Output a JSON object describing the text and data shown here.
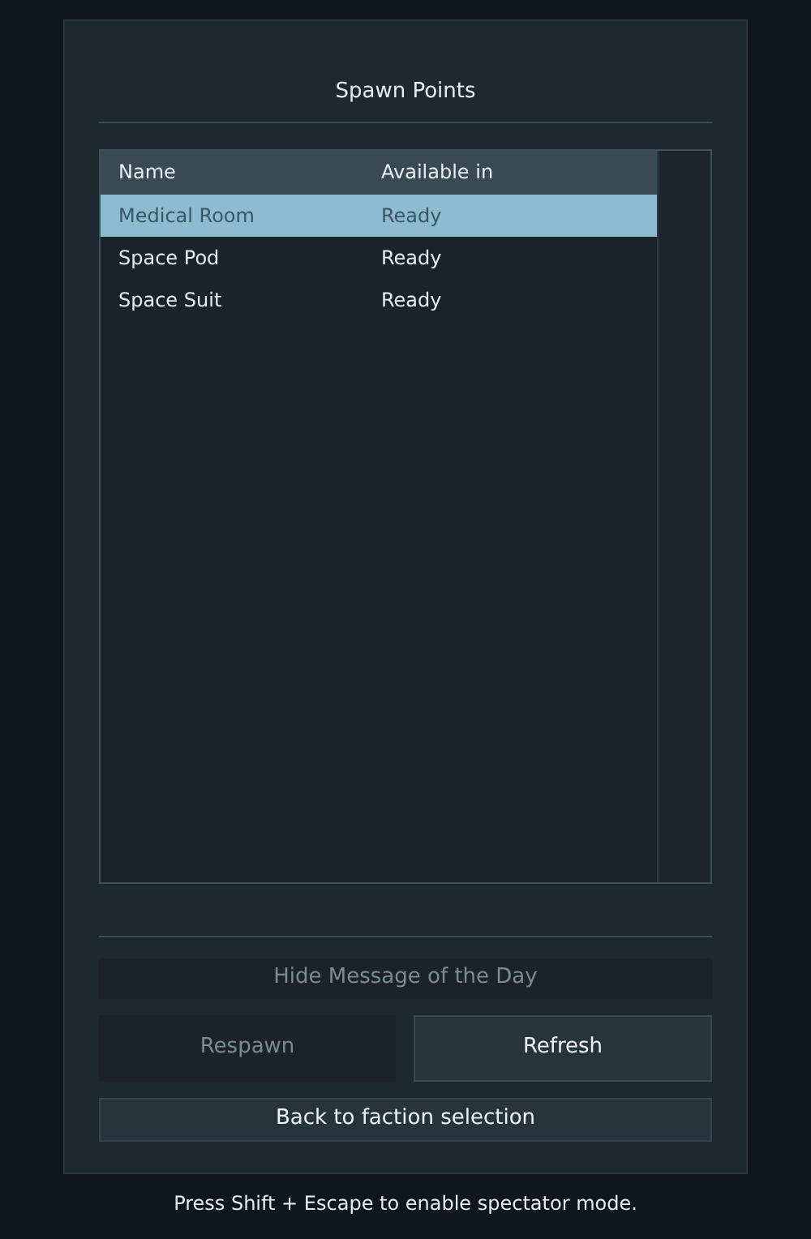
{
  "window": {
    "title": "Spawn Points"
  },
  "table": {
    "columns": [
      "Name",
      "Available in"
    ],
    "rows": [
      {
        "name": "Medical Room",
        "available_in": "Ready",
        "selected": true
      },
      {
        "name": "Space Pod",
        "available_in": "Ready",
        "selected": false
      },
      {
        "name": "Space Suit",
        "available_in": "Ready",
        "selected": false
      }
    ]
  },
  "motd_button": {
    "label": "Hide Message of the Day",
    "disabled": true
  },
  "buttons": [
    {
      "label": "Respawn",
      "disabled": true
    },
    {
      "label": "Refresh",
      "disabled": false
    }
  ],
  "back_button": {
    "label": "Back to faction selection",
    "disabled": false
  },
  "hint": "Press Shift + Escape to enable spectator mode."
}
